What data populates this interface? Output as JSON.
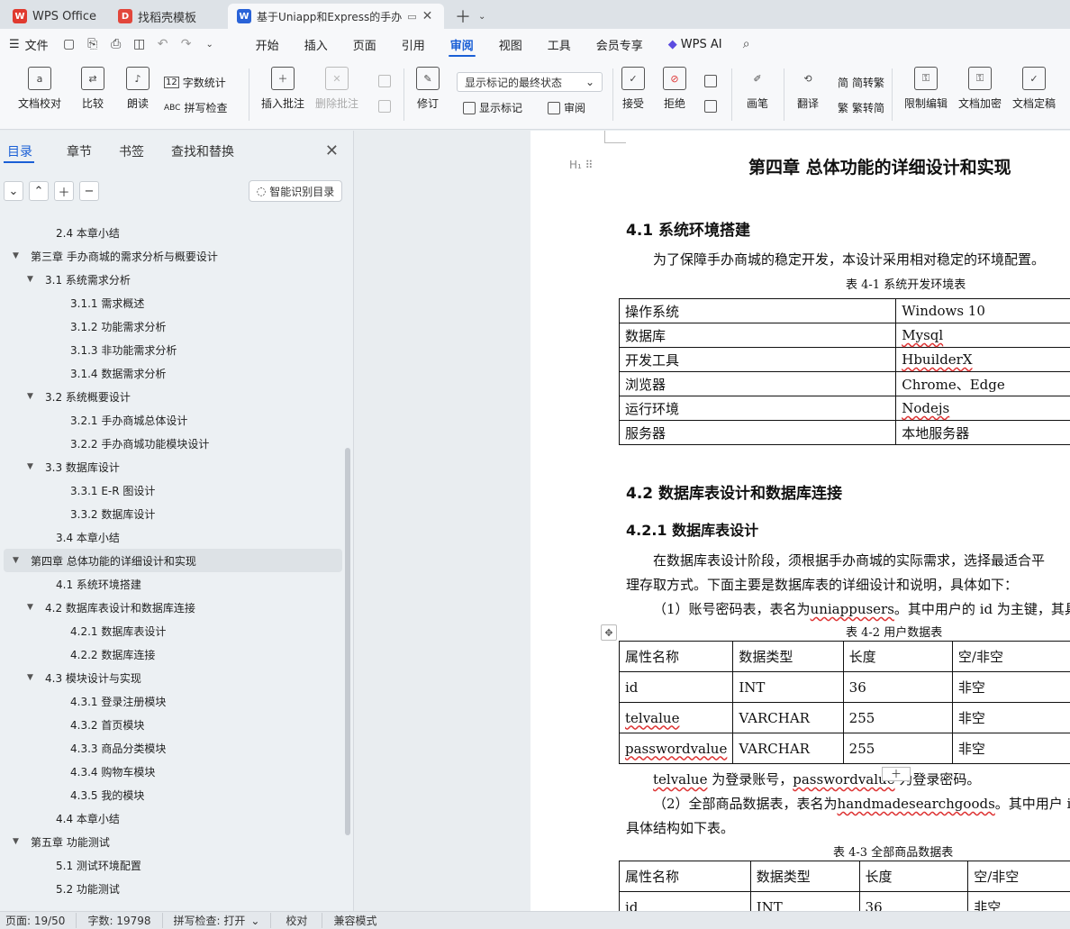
{
  "tabs": [
    {
      "label": "WPS Office",
      "logo": "W"
    },
    {
      "label": "找稻壳模板",
      "logo": "D"
    },
    {
      "label": "基于Uniapp和Express的手办",
      "logo": "W"
    }
  ],
  "menu": {
    "file": "文件",
    "items": [
      "开始",
      "插入",
      "页面",
      "引用",
      "审阅",
      "视图",
      "工具",
      "会员专享"
    ],
    "active": "审阅",
    "ai": "WPS AI"
  },
  "ribbon": {
    "doc_check": "文档校对",
    "compare": "比较",
    "read": "朗读",
    "word_count": "字数统计",
    "spell_check": "拼写检查",
    "insert_comment": "插入批注",
    "delete_comment": "删除批注",
    "revise": "修订",
    "markup_select": "显示标记的最终状态",
    "show_markup": "显示标记",
    "review": "审阅",
    "accept": "接受",
    "reject": "拒绝",
    "pen": "画笔",
    "translate": "翻译",
    "to_traditional": "简转繁",
    "to_simplified": "繁转简",
    "restrict": "限制编辑",
    "encrypt": "文档加密",
    "finalize": "文档定稿"
  },
  "panel": {
    "tabs": [
      "目录",
      "章节",
      "书签",
      "查找和替换"
    ],
    "smart": "智能识别目录",
    "toc": [
      {
        "t": "2.4 本章小结",
        "lv": 2,
        "arrow": false
      },
      {
        "t": "第三章 手办商城的需求分析与概要设计",
        "lv": 1,
        "arrow": true
      },
      {
        "t": "3.1 系统需求分析",
        "lv": 2,
        "arrow": true
      },
      {
        "t": "3.1.1 需求概述",
        "lv": 3,
        "arrow": false
      },
      {
        "t": "3.1.2 功能需求分析",
        "lv": 3,
        "arrow": false
      },
      {
        "t": "3.1.3 非功能需求分析",
        "lv": 3,
        "arrow": false
      },
      {
        "t": "3.1.4 数据需求分析",
        "lv": 3,
        "arrow": false
      },
      {
        "t": "3.2 系统概要设计",
        "lv": 2,
        "arrow": true
      },
      {
        "t": "3.2.1 手办商城总体设计",
        "lv": 3,
        "arrow": false
      },
      {
        "t": "3.2.2 手办商城功能模块设计",
        "lv": 3,
        "arrow": false
      },
      {
        "t": "3.3 数据库设计",
        "lv": 2,
        "arrow": true
      },
      {
        "t": "3.3.1 E-R 图设计",
        "lv": 3,
        "arrow": false
      },
      {
        "t": "3.3.2 数据库设计",
        "lv": 3,
        "arrow": false
      },
      {
        "t": "3.4 本章小结",
        "lv": 2,
        "arrow": false
      },
      {
        "t": "第四章 总体功能的详细设计和实现",
        "lv": 1,
        "arrow": true,
        "sel": true
      },
      {
        "t": "4.1 系统环境搭建",
        "lv": 2,
        "arrow": false
      },
      {
        "t": "4.2 数据库表设计和数据库连接",
        "lv": 2,
        "arrow": true
      },
      {
        "t": "4.2.1 数据库表设计",
        "lv": 3,
        "arrow": false
      },
      {
        "t": "4.2.2 数据库连接",
        "lv": 3,
        "arrow": false
      },
      {
        "t": "4.3 模块设计与实现",
        "lv": 2,
        "arrow": true
      },
      {
        "t": "4.3.1 登录注册模块",
        "lv": 3,
        "arrow": false
      },
      {
        "t": "4.3.2 首页模块",
        "lv": 3,
        "arrow": false
      },
      {
        "t": "4.3.3 商品分类模块",
        "lv": 3,
        "arrow": false
      },
      {
        "t": "4.3.4 购物车模块",
        "lv": 3,
        "arrow": false
      },
      {
        "t": "4.3.5 我的模块",
        "lv": 3,
        "arrow": false
      },
      {
        "t": "4.4 本章小结",
        "lv": 2,
        "arrow": false
      },
      {
        "t": "第五章 功能测试",
        "lv": 1,
        "arrow": true
      },
      {
        "t": "5.1 测试环境配置",
        "lv": 2,
        "arrow": false
      },
      {
        "t": "5.2 功能测试",
        "lv": 2,
        "arrow": false
      }
    ]
  },
  "doc": {
    "chapter": "第四章 总体功能的详细设计和实现",
    "s41": "4.1 系统环境搭建",
    "p41": "为了保障手办商城的稳定开发，本设计采用相对稳定的环境配置。",
    "cap41": "表 4-1 系统开发环境表",
    "env": [
      [
        "操作系统",
        "Windows 10"
      ],
      [
        "数据库",
        "Mysql"
      ],
      [
        "开发工具",
        "HbuilderX"
      ],
      [
        "浏览器",
        "Chrome、Edge"
      ],
      [
        "运行环境",
        "Nodejs"
      ],
      [
        "服务器",
        "本地服务器"
      ]
    ],
    "s42": "4.2 数据库表设计和数据库连接",
    "s421": "4.2.1 数据库表设计",
    "p421a": "在数据库表设计阶段，须根据手办商城的实际需求，选择最适合平",
    "p421b": "理存取方式。下面主要是数据库表的详细设计和说明，具体如下：",
    "p1_pre": "（1）账号密码表，表名为",
    "p1_name": "uniappusers",
    "p1_post": "。其中用户的 id 为主键，其具",
    "cap42": "表 4-2 用户数据表",
    "t42": [
      [
        "属性名称",
        "数据类型",
        "长度",
        "空/非空"
      ],
      [
        "id",
        "INT",
        "36",
        "非空"
      ],
      [
        "telvalue",
        "VARCHAR",
        "255",
        "非空"
      ],
      [
        "passwordvalue",
        "VARCHAR",
        "255",
        "非空"
      ]
    ],
    "note_a": "telvalue",
    "note_b": " 为登录账号，",
    "note_c": "passwordvalue",
    "note_d": " 为登录密码。",
    "p2_pre": "（2）全部商品数据表，表名为",
    "p2_name": "handmadesearchgoods",
    "p2_post": "。其中用户 id",
    "p2b": "具体结构如下表。",
    "cap43": "表 4-3 全部商品数据表",
    "t43": [
      [
        "属性名称",
        "数据类型",
        "长度",
        "空/非空"
      ],
      [
        "id",
        "INT",
        "36",
        "非空"
      ]
    ]
  },
  "status": {
    "page": "页面: 19/50",
    "words": "字数: 19798",
    "spell": "拼写检查: 打开",
    "proof": "校对",
    "compat": "兼容模式"
  }
}
